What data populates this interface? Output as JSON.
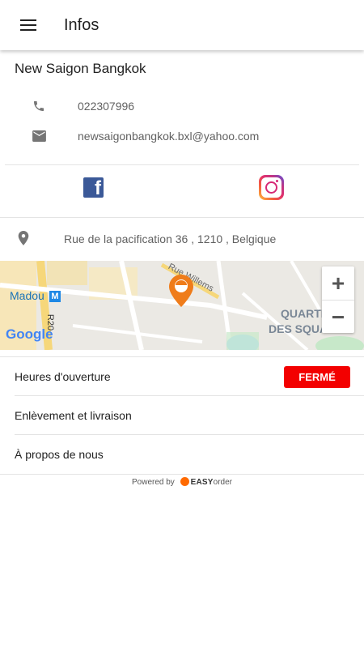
{
  "appbar": {
    "title": "Infos",
    "menu_icon": "menu-icon"
  },
  "restaurant": {
    "name": "New Saigon Bangkok",
    "phone": "022307996",
    "email": "newsaigonbangkok.bxl@yahoo.com",
    "address": "Rue de la pacification 36 , 1210 , Belgique"
  },
  "social": {
    "facebook_icon": "facebook-icon",
    "instagram_icon": "instagram-icon"
  },
  "map": {
    "labels": {
      "station": "Madou",
      "street": "Rue Willems",
      "district_line1": "QUARTIER",
      "district_line2": "DES SQUARES",
      "road": "R20"
    },
    "zoom_in": "+",
    "zoom_out": "−",
    "google": "Google"
  },
  "menu": {
    "hours_label": "Heures d'ouverture",
    "status": "FERMÉ",
    "status_color": "#f30000",
    "pickup_label": "Enlèvement et livraison",
    "about_label": "À propos de nous"
  },
  "footer": {
    "powered_by": "Powered by",
    "brand_prefix": "EASY",
    "brand_suffix": "order"
  }
}
